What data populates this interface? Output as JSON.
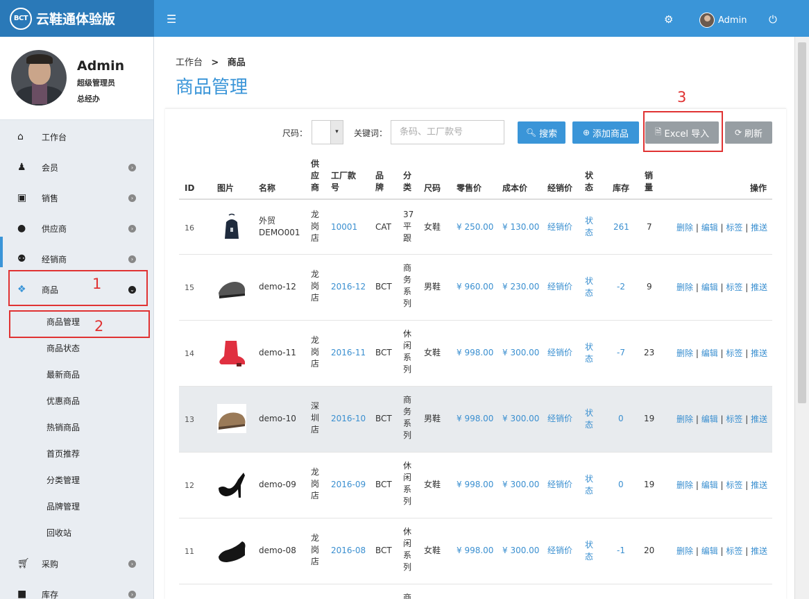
{
  "app": {
    "logo_text": "云鞋通体验版",
    "logo_mark": "BCT"
  },
  "topbar": {
    "menu_icon": "hamburger-icon",
    "settings_icon": "gear-icon",
    "user": "Admin",
    "logout_icon": "power-icon"
  },
  "profile": {
    "name": "Admin",
    "role": "超级管理员",
    "title": "总经办"
  },
  "sidebar": {
    "items": [
      {
        "label": "工作台",
        "icon": "home-icon"
      },
      {
        "label": "会员",
        "icon": "member-icon"
      },
      {
        "label": "销售",
        "icon": "money-icon"
      },
      {
        "label": "供应商",
        "icon": "user-icon"
      },
      {
        "label": "经销商",
        "icon": "users-icon"
      },
      {
        "label": "商品",
        "icon": "cubes-icon"
      },
      {
        "label": "采购",
        "icon": "cart-icon"
      },
      {
        "label": "库存",
        "icon": "box-icon"
      }
    ],
    "subitems": [
      "商品管理",
      "商品状态",
      "最新商品",
      "优惠商品",
      "热销商品",
      "首页推荐",
      "分类管理",
      "品牌管理",
      "回收站"
    ]
  },
  "annotations": {
    "n1": "1",
    "n2": "2",
    "n3": "3"
  },
  "breadcrumb": {
    "home": "工作台",
    "sep": ">",
    "current": "商品"
  },
  "page_title": "商品管理",
  "filters": {
    "size_label": "尺码：",
    "size_value": "",
    "keyword_label": "关键词：",
    "keyword_placeholder": "条码、工厂款号"
  },
  "buttons": {
    "search": "搜索",
    "add": "添加商品",
    "excel": "Excel 导入",
    "refresh": "刷新"
  },
  "table": {
    "headers": {
      "id": "ID",
      "image": "图片",
      "name": "名称",
      "supplier": [
        "供",
        "应",
        "商"
      ],
      "factory_no": [
        "工厂款",
        "号"
      ],
      "brand": [
        "品",
        "牌"
      ],
      "category": [
        "分",
        "类"
      ],
      "size": "尺码",
      "retail": "零售价",
      "cost": "成本价",
      "dealer": "经销价",
      "status": [
        "状",
        "态"
      ],
      "stock": "库存",
      "sales": [
        "销",
        "量"
      ],
      "ops": "操作"
    },
    "rows": [
      {
        "id": "16",
        "name": [
          "外贸",
          "DEMO001"
        ],
        "supplier": [
          "龙",
          "岗",
          "店"
        ],
        "factory_no": "10001",
        "brand": "CAT",
        "category": [
          "37",
          "平",
          "跟"
        ],
        "size": "女鞋",
        "retail": "¥ 250.00",
        "cost": "¥ 130.00",
        "dealer": "经销价",
        "status": [
          "状",
          "态"
        ],
        "stock": "261",
        "sales": "7"
      },
      {
        "id": "15",
        "name": [
          "demo-12"
        ],
        "supplier": [
          "龙",
          "岗",
          "店"
        ],
        "factory_no": "2016-12",
        "brand": "BCT",
        "category": [
          "商",
          "务",
          "系",
          "列"
        ],
        "size": "男鞋",
        "retail": "¥ 960.00",
        "cost": "¥ 230.00",
        "dealer": "经销价",
        "status": [
          "状",
          "态"
        ],
        "stock": "-2",
        "sales": "9"
      },
      {
        "id": "14",
        "name": [
          "demo-11"
        ],
        "supplier": [
          "龙",
          "岗",
          "店"
        ],
        "factory_no": "2016-11",
        "brand": "BCT",
        "category": [
          "休",
          "闲",
          "系",
          "列"
        ],
        "size": "女鞋",
        "retail": "¥ 998.00",
        "cost": "¥ 300.00",
        "dealer": "经销价",
        "status": [
          "状",
          "态"
        ],
        "stock": "-7",
        "sales": "23"
      },
      {
        "id": "13",
        "name": [
          "demo-10"
        ],
        "supplier": [
          "深",
          "圳",
          "店"
        ],
        "factory_no": "2016-10",
        "brand": "BCT",
        "category": [
          "商",
          "务",
          "系",
          "列"
        ],
        "size": "男鞋",
        "retail": "¥ 998.00",
        "cost": "¥ 300.00",
        "dealer": "经销价",
        "status": [
          "状",
          "态"
        ],
        "stock": "0",
        "sales": "19"
      },
      {
        "id": "12",
        "name": [
          "demo-09"
        ],
        "supplier": [
          "龙",
          "岗",
          "店"
        ],
        "factory_no": "2016-09",
        "brand": "BCT",
        "category": [
          "休",
          "闲",
          "系",
          "列"
        ],
        "size": "女鞋",
        "retail": "¥ 998.00",
        "cost": "¥ 300.00",
        "dealer": "经销价",
        "status": [
          "状",
          "态"
        ],
        "stock": "0",
        "sales": "19"
      },
      {
        "id": "11",
        "name": [
          "demo-08"
        ],
        "supplier": [
          "龙",
          "岗",
          "店"
        ],
        "factory_no": "2016-08",
        "brand": "BCT",
        "category": [
          "休",
          "闲",
          "系",
          "列"
        ],
        "size": "女鞋",
        "retail": "¥ 998.00",
        "cost": "¥ 300.00",
        "dealer": "经销价",
        "status": [
          "状",
          "态"
        ],
        "stock": "-1",
        "sales": "20"
      }
    ],
    "ops": {
      "delete": "删除",
      "edit": "编辑",
      "tag": "标签",
      "push": "推送",
      "sep": " | "
    },
    "partial_next_row_char": "商"
  }
}
